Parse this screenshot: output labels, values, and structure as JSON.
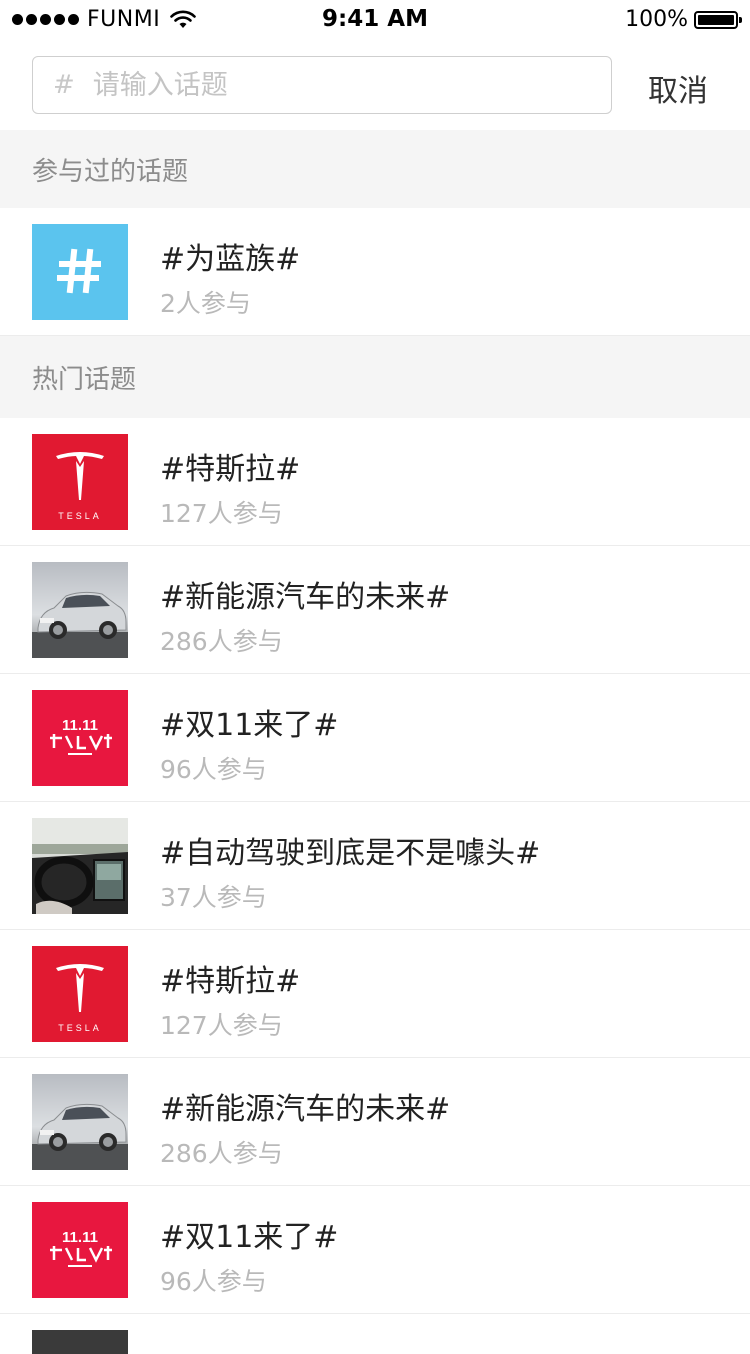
{
  "status_bar": {
    "carrier": "FUNMI",
    "time": "9:41 AM",
    "battery": "100%"
  },
  "search": {
    "hash_symbol": "#",
    "placeholder": "请输入话题",
    "value": "",
    "cancel_label": "取消"
  },
  "participated": {
    "header": "参与过的话题",
    "items": [
      {
        "title": "#为蓝族#",
        "count": "2人参与",
        "icon": "hash-icon",
        "thumb_text": "#"
      }
    ]
  },
  "hot": {
    "header": "热门话题",
    "items": [
      {
        "title": "#特斯拉#",
        "count": "127人参与",
        "icon": "tesla-logo",
        "thumb_text": "TESLA"
      },
      {
        "title": "#新能源汽车的未来#",
        "count": "286人参与",
        "icon": "car-photo"
      },
      {
        "title": "#双11来了#",
        "count": "96人参与",
        "icon": "double11-logo",
        "thumb_text": "11.11"
      },
      {
        "title": "#自动驾驶到底是不是噱头#",
        "count": "37人参与",
        "icon": "car-interior-photo"
      },
      {
        "title": "#特斯拉#",
        "count": "127人参与",
        "icon": "tesla-logo",
        "thumb_text": "TESLA"
      },
      {
        "title": "#新能源汽车的未来#",
        "count": "286人参与",
        "icon": "car-photo"
      },
      {
        "title": "#双11来了#",
        "count": "96人参与",
        "icon": "double11-logo",
        "thumb_text": "11.11"
      }
    ]
  },
  "colors": {
    "hash_tile": "#5bc4ee",
    "tesla_red": "#e11931",
    "double11_red": "#e8173f",
    "secondary_text": "#b9b9b9",
    "section_bg": "#f5f5f5"
  }
}
